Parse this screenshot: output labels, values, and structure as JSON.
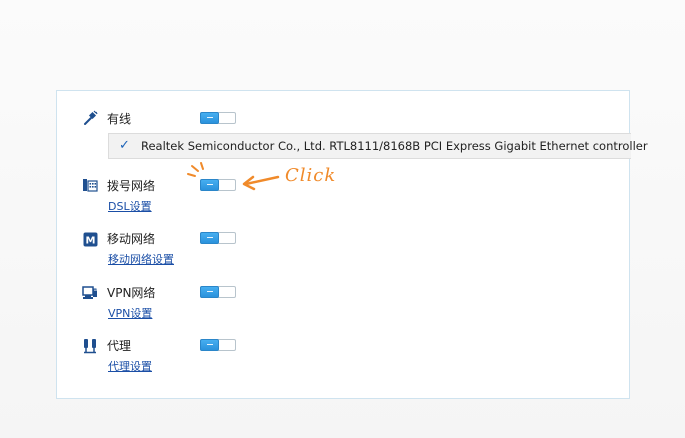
{
  "network": {
    "wired": {
      "label": "有线",
      "icon": "ethernet-plug-icon",
      "enabled": true,
      "device": {
        "name": "Realtek Semiconductor Co., Ltd. RTL8111/8168B PCI Express Gigabit Ethernet controller",
        "selected": true
      }
    },
    "dsl": {
      "label": "拨号网络",
      "icon": "dialup-icon",
      "enabled": true,
      "settings_link": "DSL设置"
    },
    "mobile": {
      "label": "移动网络",
      "icon": "mobile-network-icon",
      "icon_text": "M",
      "enabled": true,
      "settings_link": "移动网络设置"
    },
    "vpn": {
      "label": "VPN网络",
      "icon": "vpn-icon",
      "enabled": true,
      "settings_link": "VPN设置"
    },
    "proxy": {
      "label": "代理",
      "icon": "proxy-icon",
      "enabled": true,
      "settings_link": "代理设置"
    }
  },
  "annotation": {
    "text": "Click",
    "color": "#f08a2a"
  },
  "colors": {
    "toggle_on": "#2b92dc",
    "link": "#1a4ea6",
    "panel_border": "#cfe3ef",
    "check": "#1d63b8"
  }
}
